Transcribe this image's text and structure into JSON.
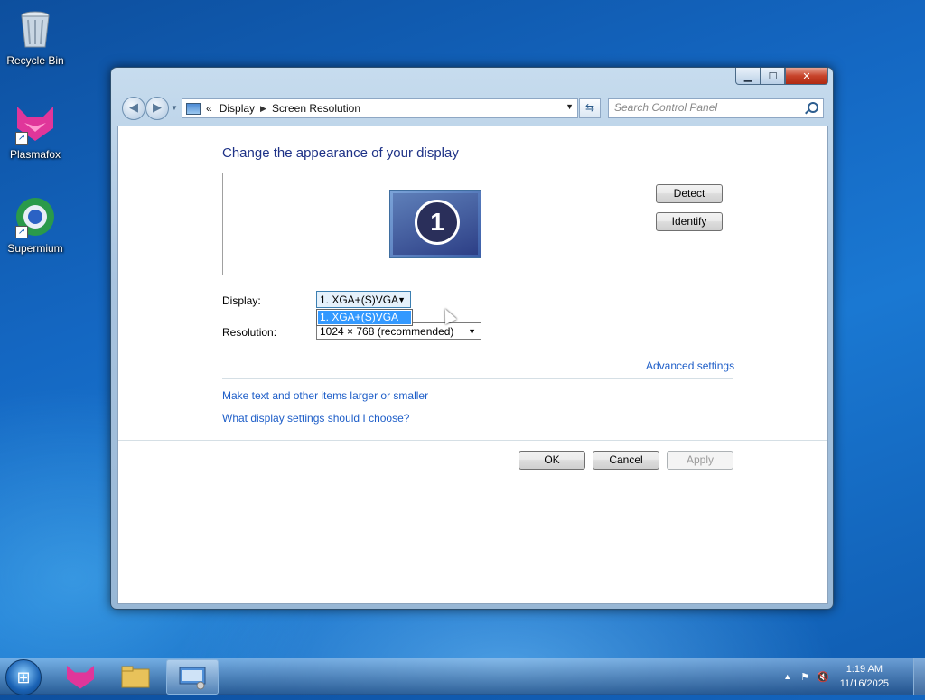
{
  "desktop": {
    "icons": [
      {
        "label": "Recycle Bin",
        "icon": "recycle-bin-icon"
      },
      {
        "label": "Plasmafox",
        "icon": "plasmafox-icon"
      },
      {
        "label": "Supermium",
        "icon": "supermium-icon"
      }
    ]
  },
  "window": {
    "address": {
      "chevron": "«",
      "crumbs": [
        "Display",
        "Screen Resolution"
      ]
    },
    "search": {
      "placeholder": "Search Control Panel"
    },
    "heading": "Change the appearance of your display",
    "monitor_number": "1",
    "buttons": {
      "detect": "Detect",
      "identify": "Identify",
      "ok": "OK",
      "cancel": "Cancel",
      "apply": "Apply"
    },
    "display": {
      "label": "Display:",
      "selected": "1. XGA+(S)VGA",
      "options": [
        "1. XGA+(S)VGA"
      ]
    },
    "resolution": {
      "label": "Resolution:",
      "selected": "1024 × 768 (recommended)"
    },
    "links": {
      "advanced": "Advanced settings",
      "text_size": "Make text and other items larger or smaller",
      "help": "What display settings should I choose?"
    }
  },
  "taskbar": {
    "items": [
      "start-orb",
      "plasmafox",
      "file-explorer",
      "screen-resolution"
    ],
    "clock": {
      "time": "1:19 AM",
      "date": "11/16/2025"
    }
  },
  "colors": {
    "heading": "#1e3287",
    "link": "#1e5ec8",
    "selection": "#3399ff"
  }
}
